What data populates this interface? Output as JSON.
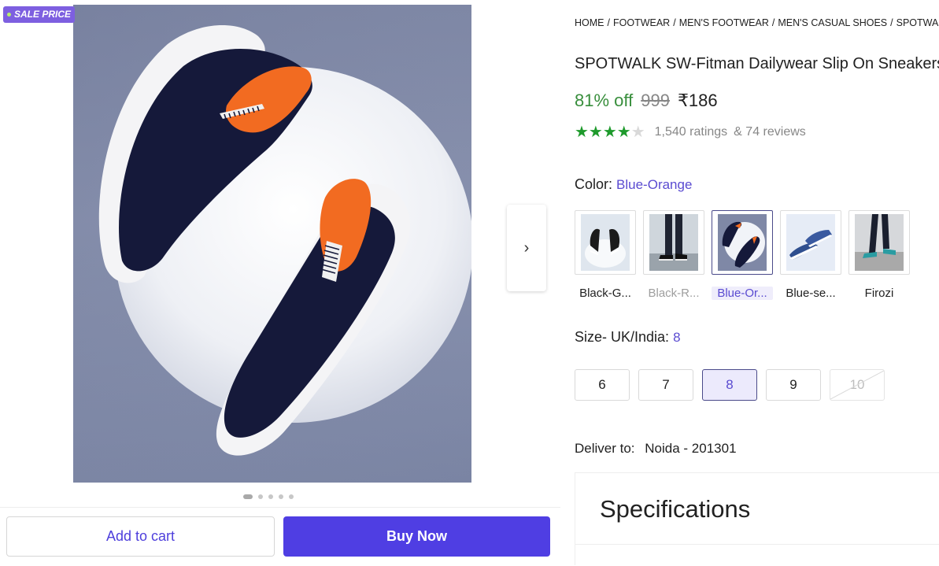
{
  "gallery": {
    "badge": "SALE PRICE",
    "next_icon": "chevron-right-icon",
    "dots": [
      true,
      false,
      false,
      false,
      false
    ]
  },
  "actions": {
    "add_to_cart": "Add to cart",
    "buy_now": "Buy Now",
    "accent": "#4f3ee3"
  },
  "breadcrumb": [
    "HOME",
    "FOOTWEAR",
    "MEN'S FOOTWEAR",
    "MEN'S CASUAL SHOES",
    "SPOTWALK CASUAL SHOES"
  ],
  "product": {
    "title": "SPOTWALK SW-Fitman Dailywear Slip On Sneakers For Men",
    "discount": "81% off",
    "mrp": "999",
    "price": "₹186",
    "rating_stars": 4,
    "ratings": "1,540 ratings",
    "reviews": "& 74 reviews"
  },
  "color": {
    "label": "Color:",
    "selected": "Blue-Orange",
    "options": [
      {
        "name": "Black-G...",
        "state": "available"
      },
      {
        "name": "Black-R...",
        "state": "out-of-stock"
      },
      {
        "name": "Blue-Or...",
        "state": "selected"
      },
      {
        "name": "Blue-se...",
        "state": "available"
      },
      {
        "name": "Firozi",
        "state": "available"
      }
    ]
  },
  "size": {
    "label": "Size- UK/India:",
    "selected": "8",
    "options": [
      {
        "value": "6",
        "state": "available"
      },
      {
        "value": "7",
        "state": "available"
      },
      {
        "value": "8",
        "state": "selected"
      },
      {
        "value": "9",
        "state": "available"
      },
      {
        "value": "10",
        "state": "unavailable"
      }
    ]
  },
  "delivery": {
    "label": "Deliver to:",
    "location": "Noida - 201301"
  },
  "specifications": {
    "title": "Specifications"
  }
}
